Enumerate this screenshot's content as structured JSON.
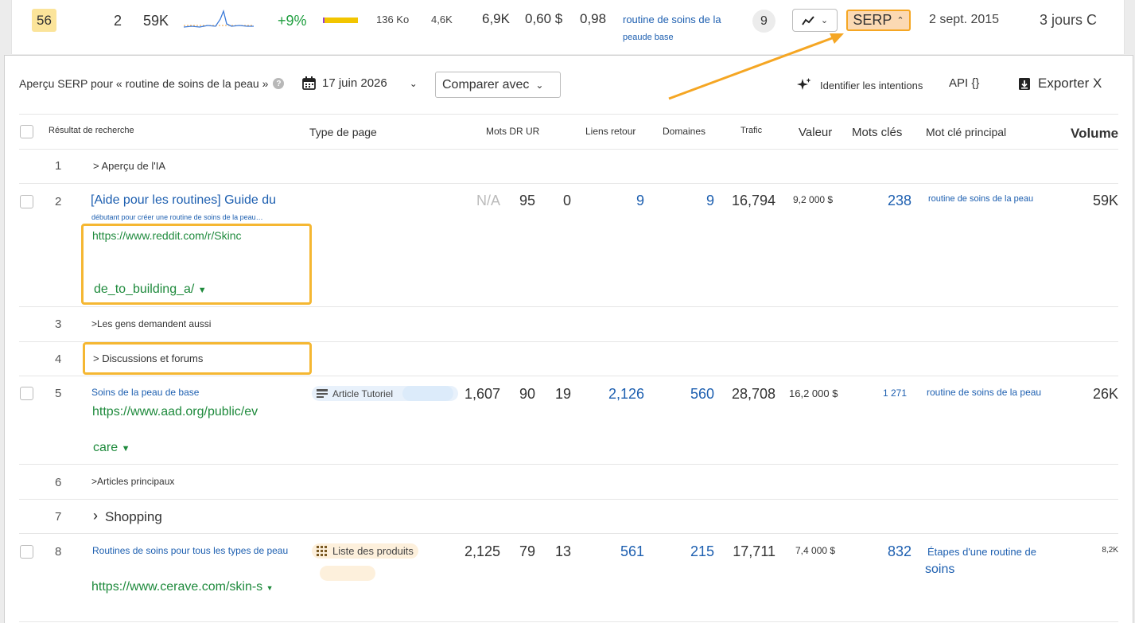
{
  "top_row": {
    "kd": "56",
    "position": "2",
    "volume": "59K",
    "change": "+9%",
    "small1": "136 Ko",
    "small2": "4,6K",
    "keywords": "6,9K",
    "cpc": "0,60 $",
    "competition": "0,98",
    "parent_topic_line1": "routine de soins de la",
    "parent_topic_line2": "peaude base",
    "serp_count": "9",
    "serp_button": "SERP",
    "date": "2 sept. 2015",
    "updated": "3 jours C"
  },
  "panel": {
    "title": "Aperçu SERP pour « routine de soins de la peau »",
    "date": "17 juin 2026",
    "compare": "Comparer avec",
    "identify_intents": "Identifier les intentions",
    "api": "API {}",
    "export": "Exporter X"
  },
  "columns": {
    "result": "Résultat de recherche",
    "page_type": "Type de page",
    "words_dr_ur": "Mots DR UR",
    "backlinks": "Liens retour",
    "domains": "Domaines",
    "traffic": "Trafic",
    "value": "Valeur",
    "keywords": "Mots clés",
    "main_keyword": "Mot clé principal",
    "volume": "Volume"
  },
  "rows": [
    {
      "n": "1",
      "label": "> Aperçu de l'IA"
    },
    {
      "n": "2",
      "title": "[Aide pour les routines] Guide du",
      "subtitle": "débutant pour créer une routine de soins de la peau…",
      "url_line1": "https://www.reddit.com/r/Skinc",
      "url_line2": "de_to_building_a/",
      "words": "N/A",
      "dr": "95",
      "ur": "0",
      "backlinks": "9",
      "domains": "9",
      "traffic": "16,794",
      "value": "9,2 000 $",
      "keywords": "238",
      "main_keyword": "routine de soins de la peau",
      "volume": "59K"
    },
    {
      "n": "3",
      "label": ">Les gens demandent aussi"
    },
    {
      "n": "4",
      "label": "> Discussions et forums"
    },
    {
      "n": "5",
      "title": "Soins de la peau de base",
      "url_line1": "https://www.aad.org/public/ev",
      "url_line2": "care",
      "page_type": "Article Tutoriel",
      "words": "1,607",
      "dr": "90",
      "ur": "19",
      "backlinks": "2,126",
      "domains": "560",
      "traffic": "28,708",
      "value": "16,2 000 $",
      "keywords": "1 271",
      "main_keyword": "routine de soins de la peau",
      "volume": "26K"
    },
    {
      "n": "6",
      "label": ">Articles principaux"
    },
    {
      "n": "7",
      "label": "Shopping"
    },
    {
      "n": "8",
      "title": "Routines de soins pour tous les types de peau",
      "url_line1": "https://www.cerave.com/skin-s",
      "page_type": "Liste des produits",
      "words": "2,125",
      "dr": "79",
      "ur": "13",
      "backlinks": "561",
      "domains": "215",
      "traffic": "17,711",
      "value": "7,4 000 $",
      "keywords": "832",
      "main_keyword_line1": "Étapes d'une routine de",
      "main_keyword_line2": "soins",
      "volume": "8,2K"
    }
  ],
  "colors": {
    "accent_orange": "#f5a623",
    "link_blue": "#1d5fb0",
    "url_green": "#1e8a3c",
    "kd_yellow": "#fbe49a"
  }
}
